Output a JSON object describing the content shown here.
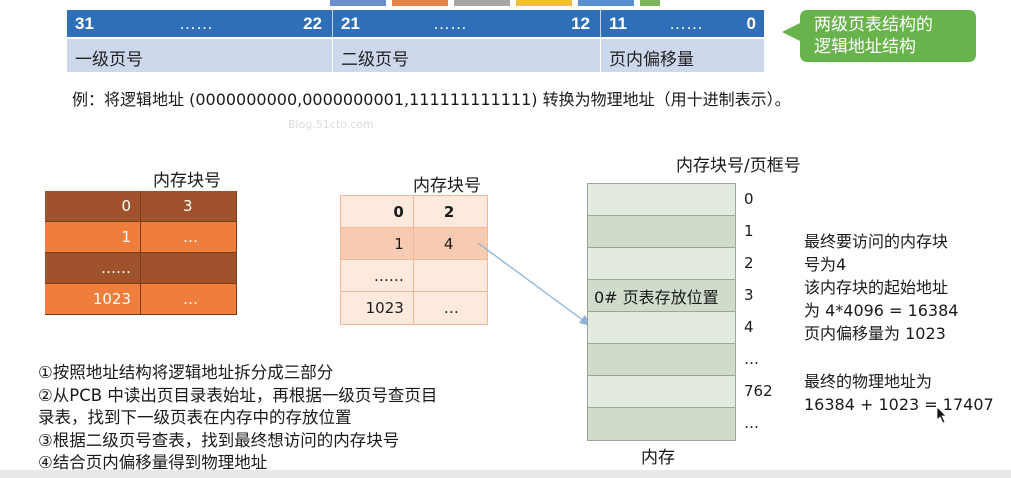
{
  "address_structure": {
    "fields": [
      {
        "high": "31",
        "dots": "……",
        "low": "22",
        "name": "一级页号"
      },
      {
        "high": "21",
        "dots": "……",
        "low": "12",
        "name": "二级页号"
      },
      {
        "high": "11",
        "dots": "……",
        "low": "0",
        "name": "页内偏移量"
      }
    ],
    "callout": [
      "两级页表结构的",
      "逻辑地址结构"
    ]
  },
  "example_text": "例：将逻辑地址 (0000000000,0000000001,111111111111) 转换为物理地址（用十进制表示）。",
  "watermark": "Blog.51cto.com",
  "top_level_table": {
    "caption": "内存块号",
    "rows": [
      {
        "index": "0",
        "value": "3"
      },
      {
        "index": "1",
        "value": "…"
      },
      {
        "index": "……",
        "value": ""
      },
      {
        "index": "1023",
        "value": "…"
      }
    ]
  },
  "second_level_table": {
    "caption": "内存块号",
    "rows": [
      {
        "index": "0",
        "value": "2"
      },
      {
        "index": "1",
        "value": "4"
      },
      {
        "index": "……",
        "value": ""
      },
      {
        "index": "1023",
        "value": "…"
      }
    ]
  },
  "memory": {
    "caption_top": "内存块号/页框号",
    "caption_bottom": "内存",
    "block_label": "0# 页表存放位置",
    "numbers": [
      "0",
      "1",
      "2",
      "3",
      "4",
      "…",
      "762",
      "…"
    ]
  },
  "notes_1": [
    "最终要访问的内存块",
    "号为4",
    "该内存块的起始地址",
    "为 4*4096 = 16384",
    "页内偏移量为 1023"
  ],
  "notes_2": [
    "最终的物理地址为",
    "16384 + 1023 = 17407"
  ],
  "steps": [
    "①按照地址结构将逻辑地址拆分成三部分",
    "②从PCB 中读出页目录表始址，再根据一级页号查页目",
    "录表，找到下一级页表在内存中的存放位置",
    "③根据二级页号查表，找到最终想访问的内存块号",
    "④结合页内偏移量得到物理地址"
  ],
  "colors": {
    "address_header": "#2f6fb8",
    "address_body": "#cdd8ec",
    "callout": "#69b34c",
    "table1_dark": "#a0522d",
    "table1_light": "#ef7d3c",
    "table2_pale": "#fde9de",
    "table2_mid": "#f7cbb1",
    "memory_light": "#e3ebdf",
    "memory_dark": "#cfdccb",
    "arrow": "#8fb2d6"
  }
}
